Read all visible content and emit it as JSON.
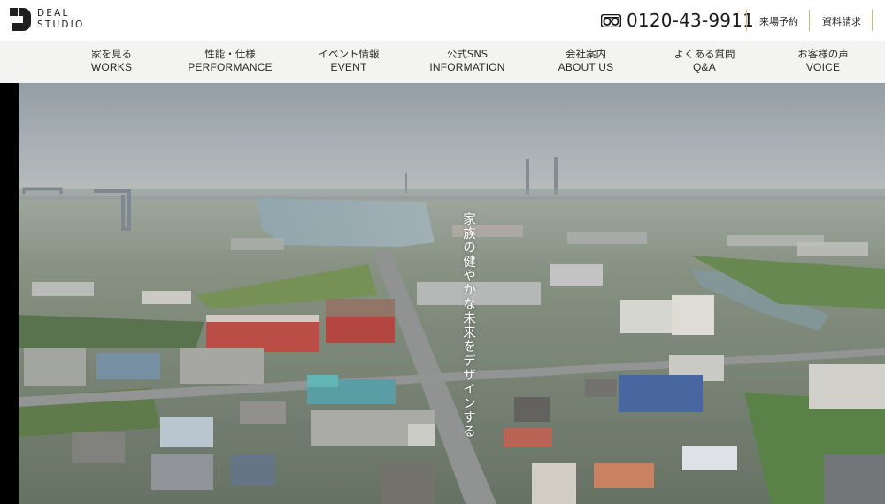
{
  "logo": {
    "line1": "DEAL",
    "line2": "STUDIO"
  },
  "header": {
    "phone_number": "0120-43-9911",
    "links": [
      "来場予約",
      "資料請求"
    ]
  },
  "nav": {
    "items": [
      {
        "ja": "家を見る",
        "en": "WORKS"
      },
      {
        "ja": "性能・仕様",
        "en": "PERFORMANCE"
      },
      {
        "ja": "イベント情報",
        "en": "EVENT"
      },
      {
        "ja": "公式SNS",
        "en": "INFORMATION"
      },
      {
        "ja": "会社案内",
        "en": "ABOUT US"
      },
      {
        "ja": "よくある質問",
        "en": "Q&A"
      },
      {
        "ja": "お客様の声",
        "en": "VOICE"
      }
    ]
  },
  "hero": {
    "tagline": "家族の健やかな未来をデザインする"
  },
  "colors": {
    "accent_gold": "#c9b87a",
    "nav_bg": "#f3f3f2",
    "text": "#222222"
  }
}
